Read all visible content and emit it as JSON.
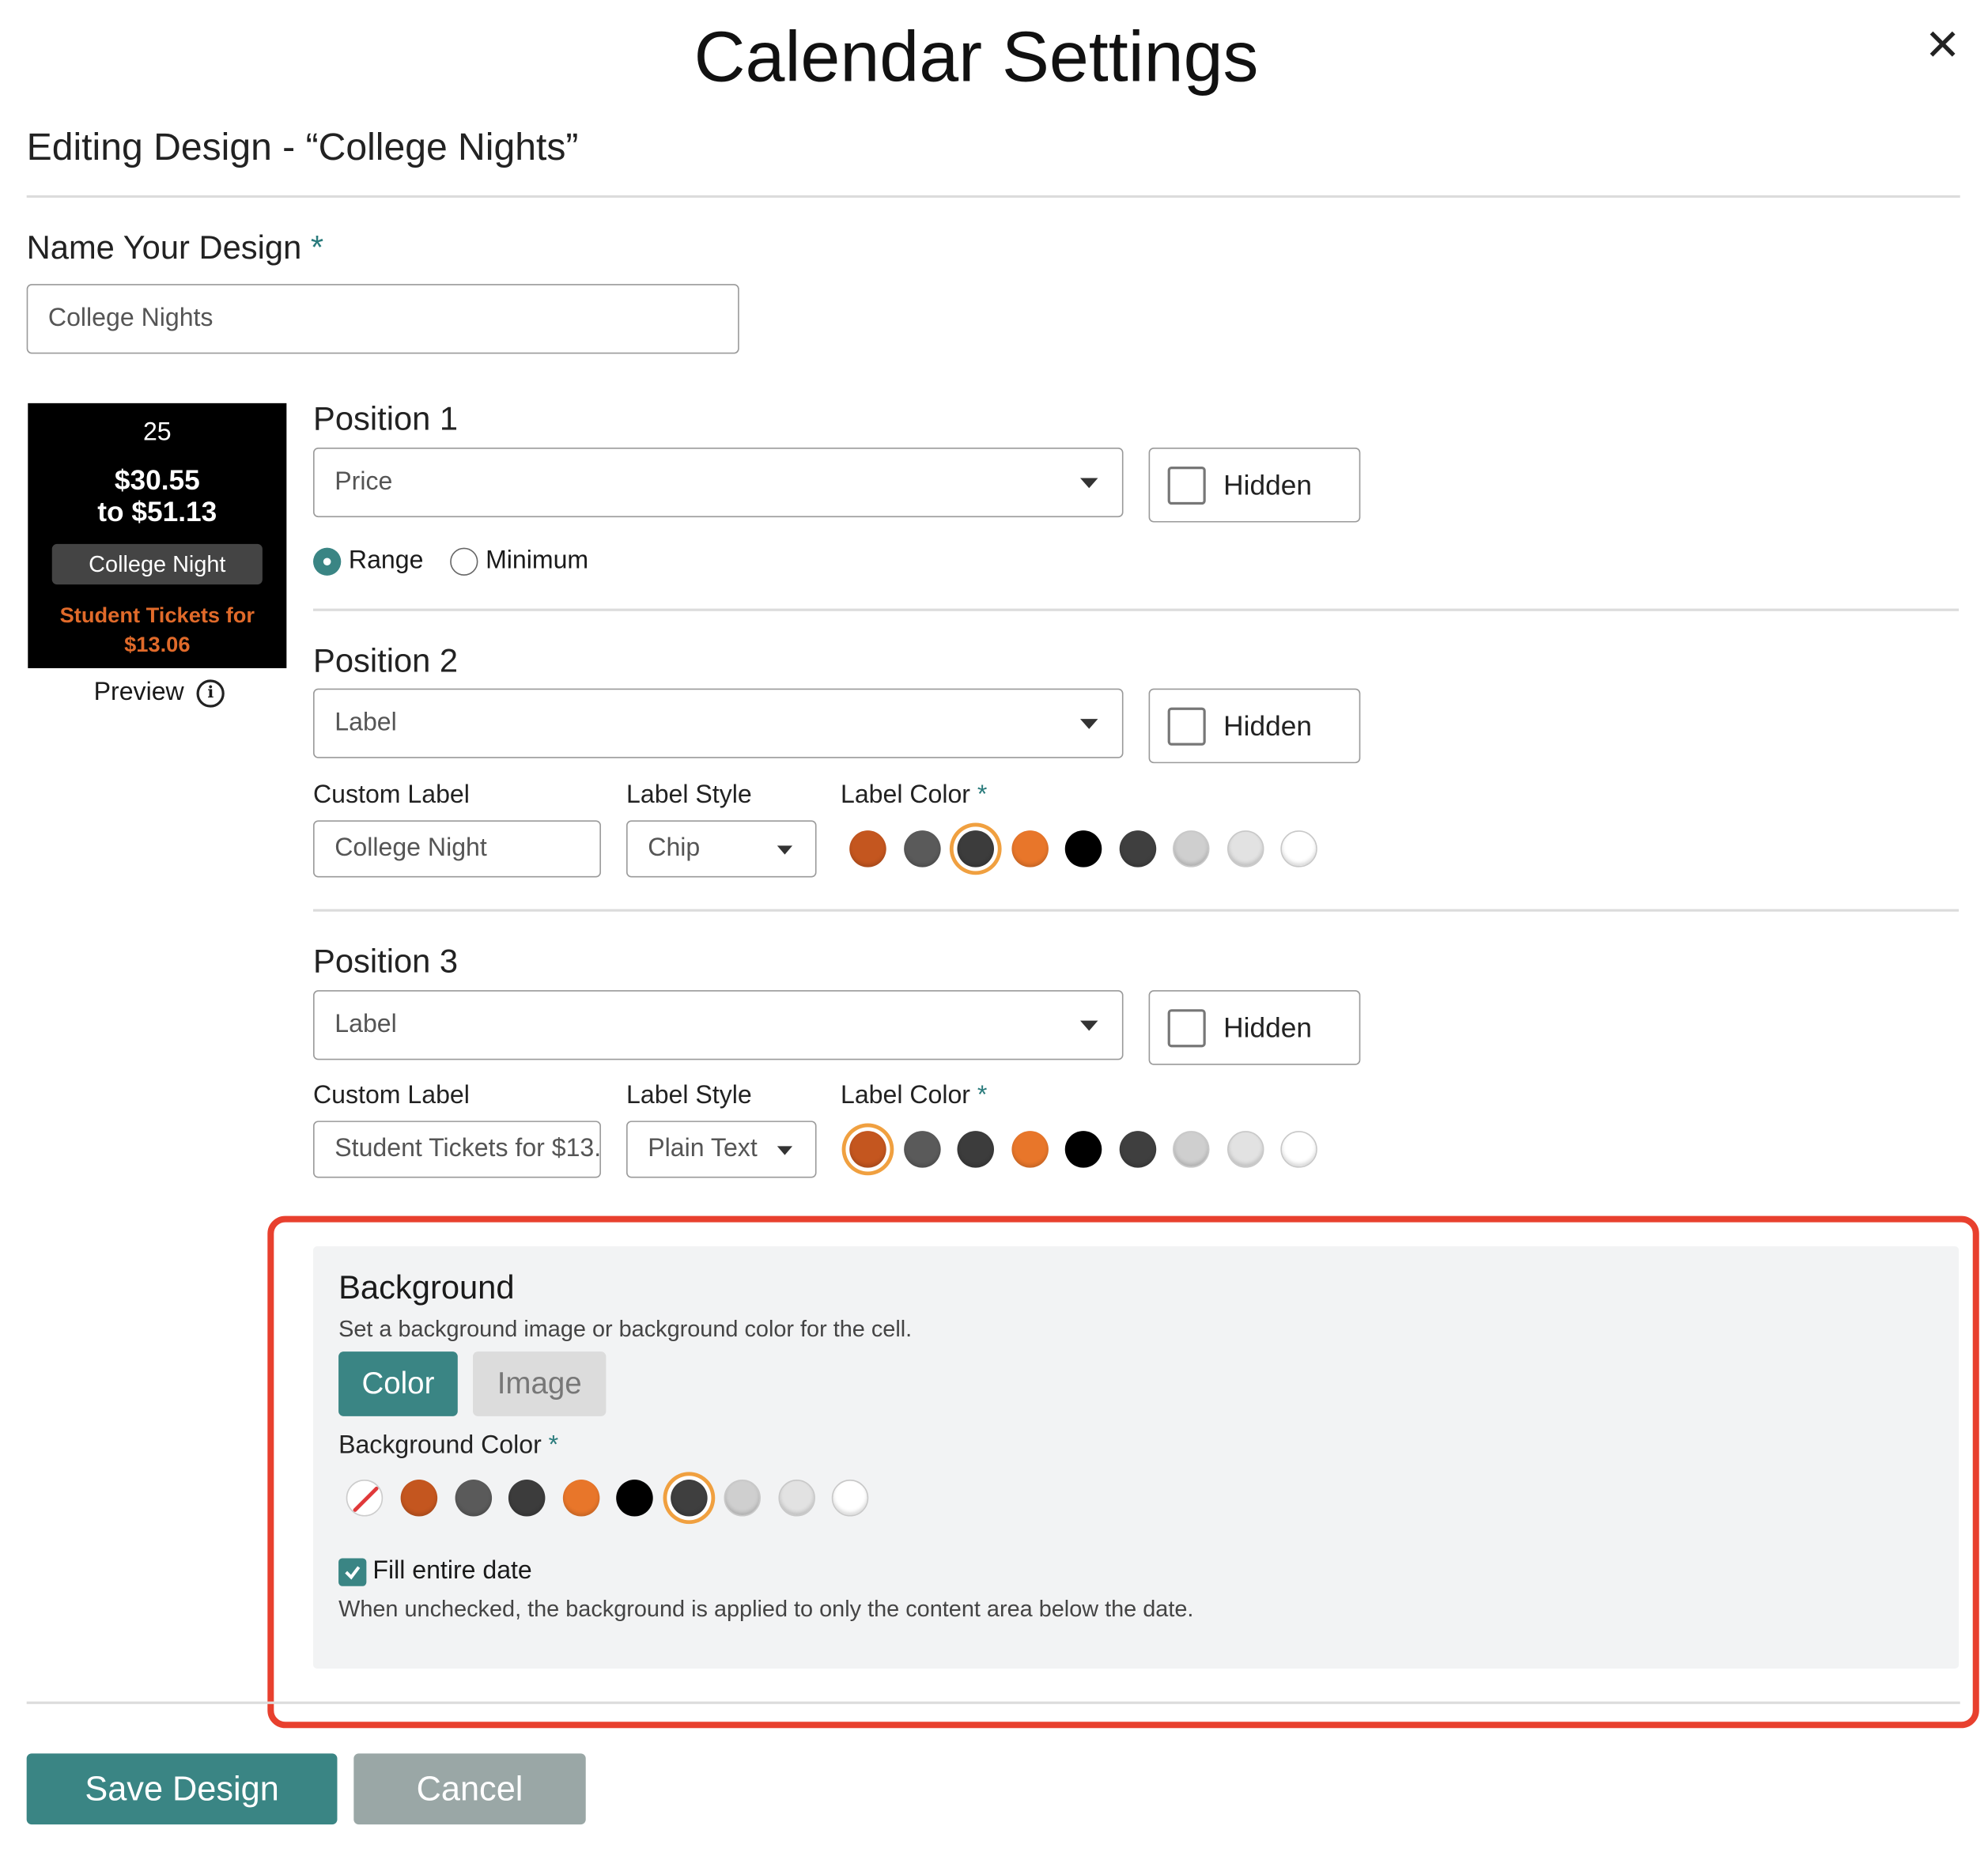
{
  "modal": {
    "title": "Calendar Settings",
    "close_glyph": "✕",
    "subtitle": "Editing Design - “College Nights”"
  },
  "name_field": {
    "label": "Name Your Design",
    "required_mark": "*",
    "value": "College Nights"
  },
  "preview": {
    "date": "25",
    "price_line1": "$30.55",
    "price_line2": "to $51.13",
    "chip": "College Night",
    "note_line1": "Student Tickets for",
    "note_line2": "$13.06",
    "label": "Preview",
    "info_glyph": "i"
  },
  "position1": {
    "heading": "Position 1",
    "select_value": "Price",
    "hidden_label": "Hidden",
    "radio_range": "Range",
    "radio_minimum": "Minimum",
    "selected_radio": "Range"
  },
  "position2": {
    "heading": "Position 2",
    "select_value": "Label",
    "hidden_label": "Hidden",
    "custom_label_title": "Custom Label",
    "custom_label_value": "College Night",
    "label_style_title": "Label Style",
    "label_style_value": "Chip",
    "label_color_title": "Label Color",
    "required_mark": "*",
    "selected_swatch_index": 2
  },
  "position3": {
    "heading": "Position 3",
    "select_value": "Label",
    "hidden_label": "Hidden",
    "custom_label_title": "Custom Label",
    "custom_label_value": "Student Tickets for $13.",
    "label_style_title": "Label Style",
    "label_style_value": "Plain Text",
    "label_color_title": "Label Color",
    "required_mark": "*",
    "selected_swatch_index": 0
  },
  "swatch_colors": [
    "#c4561f",
    "#5a5a5a",
    "#3c3c3c",
    "#e8762a",
    "#000000",
    "#3f3f3f",
    "#cfcfcf",
    "#e2e2e2",
    "#ffffff"
  ],
  "background": {
    "heading": "Background",
    "description": "Set a background image or background color for the cell.",
    "tab_color": "Color",
    "tab_image": "Image",
    "active_tab": "Color",
    "color_title": "Background Color",
    "required_mark": "*",
    "selected_swatch_index": 5,
    "fill_label": "Fill entire date",
    "fill_checked": true,
    "fill_help": "When unchecked, the background is applied to only the content area below the date."
  },
  "footer": {
    "save_label": "Save Design",
    "cancel_label": "Cancel"
  },
  "accent_color": "#3a8584",
  "highlight_color": "#e8402e"
}
